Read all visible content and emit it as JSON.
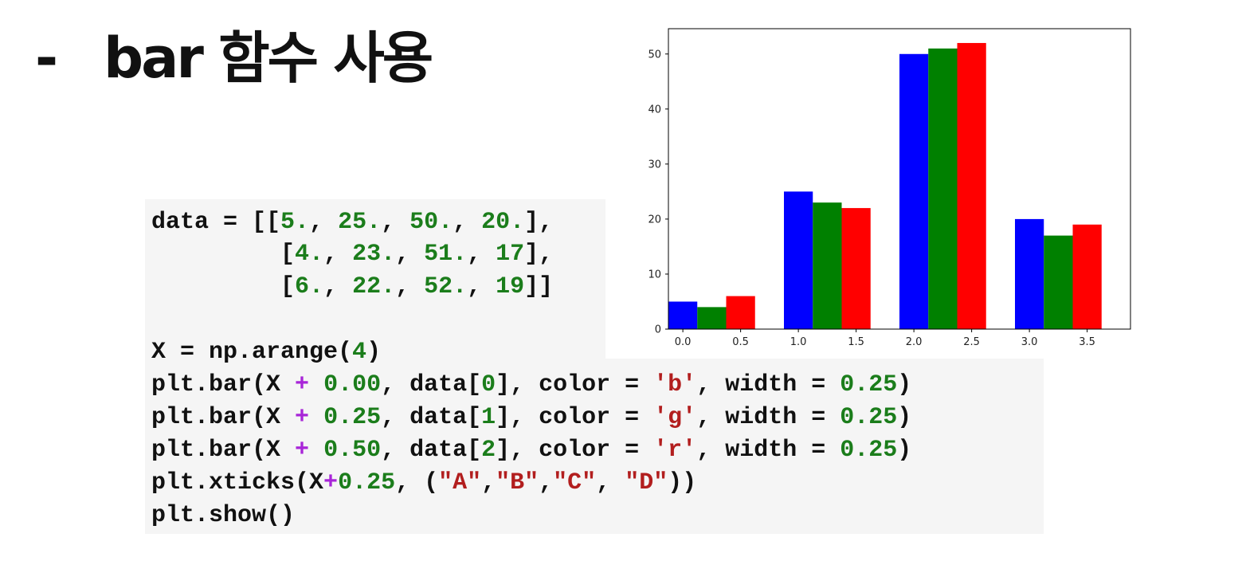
{
  "slide": {
    "dash": "-",
    "title": "bar 함수 사용"
  },
  "code": {
    "lines": [
      [
        [
          "t",
          "data = [["
        ],
        [
          "n",
          "5."
        ],
        [
          "t",
          ", "
        ],
        [
          "n",
          "25."
        ],
        [
          "t",
          ", "
        ],
        [
          "n",
          "50."
        ],
        [
          "t",
          ", "
        ],
        [
          "n",
          "20."
        ],
        [
          "t",
          "],"
        ]
      ],
      [
        [
          "t",
          "         ["
        ],
        [
          "n",
          "4."
        ],
        [
          "t",
          ", "
        ],
        [
          "n",
          "23."
        ],
        [
          "t",
          ", "
        ],
        [
          "n",
          "51."
        ],
        [
          "t",
          ", "
        ],
        [
          "n",
          "17"
        ],
        [
          "t",
          "],"
        ]
      ],
      [
        [
          "t",
          "         ["
        ],
        [
          "n",
          "6."
        ],
        [
          "t",
          ", "
        ],
        [
          "n",
          "22."
        ],
        [
          "t",
          ", "
        ],
        [
          "n",
          "52."
        ],
        [
          "t",
          ", "
        ],
        [
          "n",
          "19"
        ],
        [
          "t",
          "]]"
        ]
      ],
      [
        [
          "t",
          "X = np.arange("
        ],
        [
          "n",
          "4"
        ],
        [
          "t",
          ")"
        ]
      ],
      [
        [
          "t",
          "plt.bar(X "
        ],
        [
          "o",
          "+"
        ],
        [
          "t",
          " "
        ],
        [
          "n",
          "0.00"
        ],
        [
          "t",
          ", data["
        ],
        [
          "n",
          "0"
        ],
        [
          "t",
          "], color = "
        ],
        [
          "s",
          "'b'"
        ],
        [
          "t",
          ", width = "
        ],
        [
          "n",
          "0.25"
        ],
        [
          "t",
          ")"
        ]
      ],
      [
        [
          "t",
          "plt.bar(X "
        ],
        [
          "o",
          "+"
        ],
        [
          "t",
          " "
        ],
        [
          "n",
          "0.25"
        ],
        [
          "t",
          ", data["
        ],
        [
          "n",
          "1"
        ],
        [
          "t",
          "], color = "
        ],
        [
          "s",
          "'g'"
        ],
        [
          "t",
          ", width = "
        ],
        [
          "n",
          "0.25"
        ],
        [
          "t",
          ")"
        ]
      ],
      [
        [
          "t",
          "plt.bar(X "
        ],
        [
          "o",
          "+"
        ],
        [
          "t",
          " "
        ],
        [
          "n",
          "0.50"
        ],
        [
          "t",
          ", data["
        ],
        [
          "n",
          "2"
        ],
        [
          "t",
          "], color = "
        ],
        [
          "s",
          "'r'"
        ],
        [
          "t",
          ", width = "
        ],
        [
          "n",
          "0.25"
        ],
        [
          "t",
          ")"
        ]
      ],
      [
        [
          "t",
          "plt.xticks(X"
        ],
        [
          "o",
          "+"
        ],
        [
          "n",
          "0.25"
        ],
        [
          "t",
          ", ("
        ],
        [
          "s",
          "\"A\""
        ],
        [
          "t",
          ","
        ],
        [
          "s",
          "\"B\""
        ],
        [
          "t",
          ","
        ],
        [
          "s",
          "\"C\""
        ],
        [
          "t",
          ", "
        ],
        [
          "s",
          "\"D\""
        ],
        [
          "t",
          "))"
        ]
      ],
      [
        [
          "t",
          "plt.show()"
        ]
      ]
    ]
  },
  "chart_data": {
    "type": "bar",
    "categories": [
      "0",
      "1",
      "2",
      "3"
    ],
    "bar_width": 0.25,
    "series": [
      {
        "x_offset": 0.0,
        "color": "#0000ff",
        "values": [
          5,
          25,
          50,
          20
        ]
      },
      {
        "x_offset": 0.25,
        "color": "#008000",
        "values": [
          4,
          23,
          51,
          17
        ]
      },
      {
        "x_offset": 0.5,
        "color": "#ff0000",
        "values": [
          6,
          22,
          52,
          19
        ]
      }
    ],
    "xlim": [
      -0.125,
      3.875
    ],
    "ylim": [
      0,
      54.6
    ],
    "x_ticks": [
      0.0,
      0.5,
      1.0,
      1.5,
      2.0,
      2.5,
      3.0,
      3.5
    ],
    "x_tick_labels": [
      "0.0",
      "0.5",
      "1.0",
      "1.5",
      "2.0",
      "2.5",
      "3.0",
      "3.5"
    ],
    "y_ticks": [
      0,
      10,
      20,
      30,
      40,
      50
    ],
    "y_tick_labels": [
      "0",
      "10",
      "20",
      "30",
      "40",
      "50"
    ],
    "title": "",
    "xlabel": "",
    "ylabel": "",
    "grid": false
  }
}
